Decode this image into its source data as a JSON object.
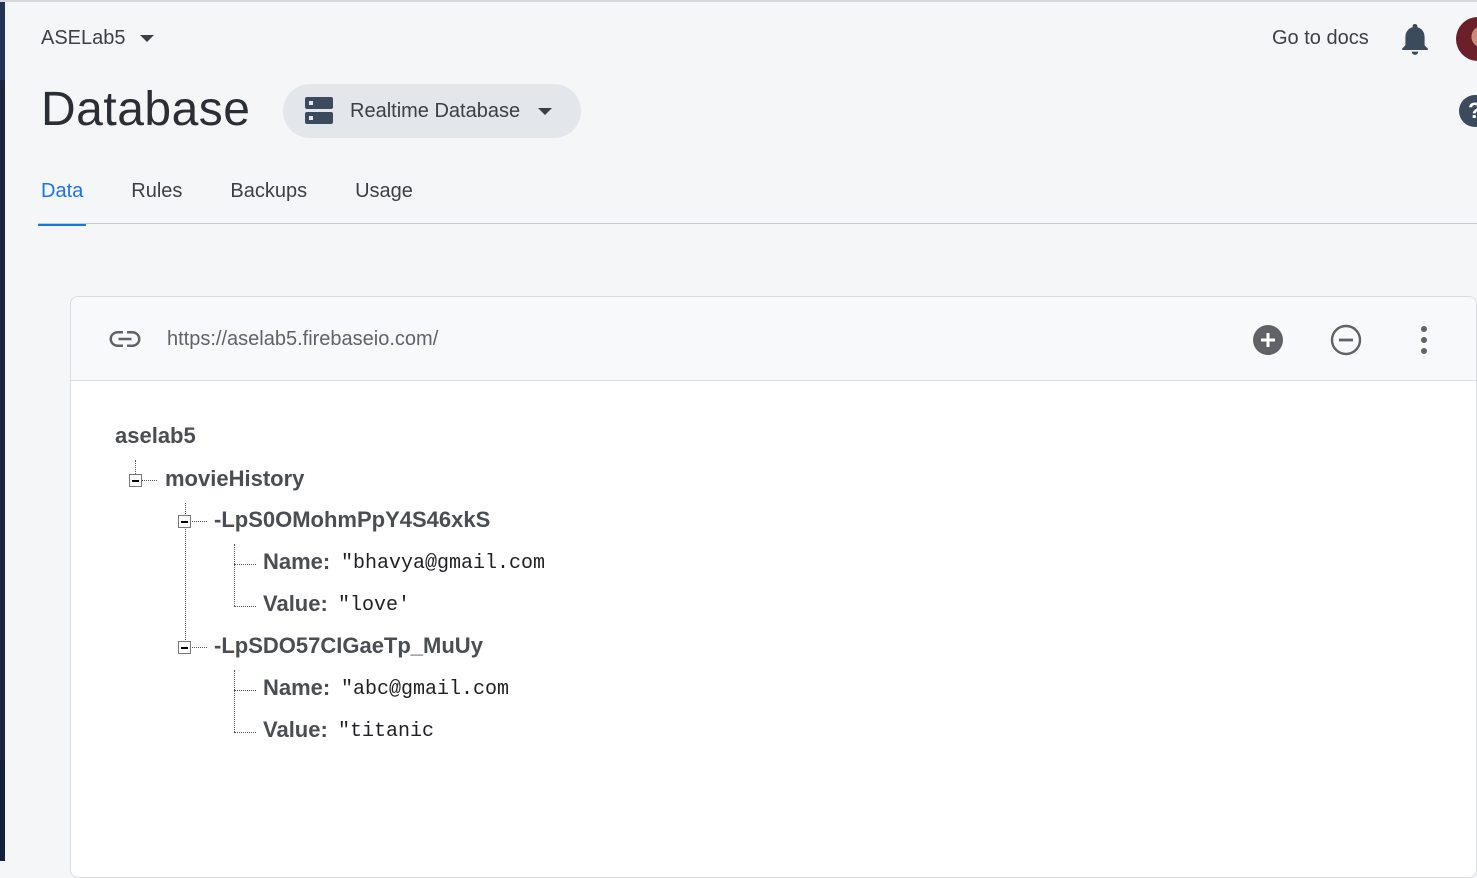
{
  "header": {
    "project_name": "ASELab5",
    "go_to_docs": "Go to docs",
    "help_symbol": "?"
  },
  "page": {
    "title": "Database",
    "db_selector": "Realtime Database"
  },
  "tabs": [
    {
      "label": "Data",
      "active": true
    },
    {
      "label": "Rules",
      "active": false
    },
    {
      "label": "Backups",
      "active": false
    },
    {
      "label": "Usage",
      "active": false
    }
  ],
  "panel": {
    "url": "https://aselab5.firebaseio.com/"
  },
  "tree": {
    "root": "aselab5",
    "child": "movieHistory",
    "entries": [
      {
        "id": "-LpS0OMohmPpY4S46xkS",
        "fields": [
          {
            "key": "Name:",
            "value": "\"bhavya@gmail.com"
          },
          {
            "key": "Value:",
            "value": "\"love'"
          }
        ]
      },
      {
        "id": "-LpSDO57CIGaeTp_MuUy",
        "fields": [
          {
            "key": "Name:",
            "value": "\"abc@gmail.com"
          },
          {
            "key": "Value:",
            "value": "\"titanic"
          }
        ]
      }
    ]
  },
  "colors": {
    "accent": "#1a73e8",
    "page_bg": "#f5f6f8",
    "rail": "#1c2540"
  },
  "icons": [
    "link-icon",
    "add-circle-icon",
    "remove-circle-icon",
    "more-vert-icon",
    "bell-icon",
    "database-icon",
    "help-icon"
  ]
}
